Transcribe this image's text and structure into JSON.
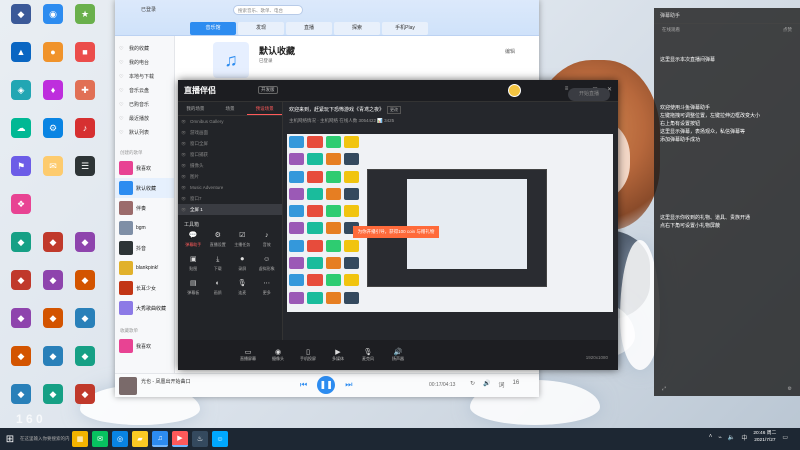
{
  "colors": {
    "accent_blue": "#2d8cf0",
    "stream_red": "#ff5a5a",
    "banner_orange": "#ff6a3a",
    "taskbar": "#1d2733"
  },
  "desktop": {
    "icons": [
      {
        "label": "desktop-icon-1",
        "icon": "shortcut-icon",
        "color": "#3b5998"
      },
      {
        "label": "desktop-icon-2",
        "icon": "shortcut-icon",
        "color": "#2d8cf0"
      },
      {
        "label": "desktop-icon-3",
        "icon": "shortcut-icon",
        "color": "#6ab04c"
      },
      {
        "label": "desktop-icon-4",
        "icon": "shortcut-icon",
        "color": "#0a66c2"
      },
      {
        "label": "desktop-icon-5",
        "icon": "shortcut-icon",
        "color": "#f0932b"
      },
      {
        "label": "desktop-icon-6",
        "icon": "shortcut-icon",
        "color": "#eb4d4b"
      },
      {
        "label": "desktop-icon-7",
        "icon": "shortcut-icon",
        "color": "#22a6b3"
      },
      {
        "label": "desktop-icon-8",
        "icon": "shortcut-icon",
        "color": "#be2edd"
      },
      {
        "label": "desktop-icon-9",
        "icon": "shortcut-icon",
        "color": "#e17055"
      },
      {
        "label": "desktop-icon-10",
        "icon": "shortcut-icon",
        "color": "#00b894"
      },
      {
        "label": "desktop-icon-11",
        "icon": "shortcut-icon",
        "color": "#0984e3"
      },
      {
        "label": "desktop-icon-12",
        "icon": "shortcut-icon",
        "color": "#d63031"
      },
      {
        "label": "desktop-icon-13",
        "icon": "shortcut-icon",
        "color": "#6c5ce7"
      },
      {
        "label": "desktop-icon-14",
        "icon": "shortcut-icon",
        "color": "#fdcb6e"
      },
      {
        "label": "desktop-icon-15",
        "icon": "shortcut-icon",
        "color": "#2d3436"
      },
      {
        "label": "desktop-icon-16",
        "icon": "shortcut-icon",
        "color": "#e84393"
      }
    ]
  },
  "music": {
    "user": "已登录",
    "search_placeholder": "搜索音乐、歌单、电台",
    "tabs": [
      {
        "label": "音乐馆",
        "active": true
      },
      {
        "label": "发现",
        "active": false
      },
      {
        "label": "直播",
        "active": false
      },
      {
        "label": "探索",
        "active": false
      },
      {
        "label": "手机Play",
        "active": false
      }
    ],
    "side_items": [
      {
        "label": "我的收藏",
        "selected": false
      },
      {
        "label": "我的电台",
        "selected": false
      },
      {
        "label": "本地与下载",
        "selected": false
      },
      {
        "label": "音乐云盘",
        "selected": false
      },
      {
        "label": "已购音乐",
        "selected": false
      },
      {
        "label": "最近播放",
        "selected": false
      },
      {
        "label": "默认列表",
        "selected": false
      }
    ],
    "playlist_section": "创建的歌单",
    "playlists": [
      {
        "label": "我喜欢",
        "color": "#e84393"
      },
      {
        "label": "默认收藏",
        "color": "#2d8cf0"
      },
      {
        "label": "伴奏",
        "color": "#9b6b6b"
      },
      {
        "label": "bgm",
        "color": "#7f8fa6"
      },
      {
        "label": "抖音",
        "color": "#2d3436"
      },
      {
        "label": "blankpink!",
        "color": "#e1b12c"
      },
      {
        "label": "长耳少女",
        "color": "#c23616"
      },
      {
        "label": "大秀歌曲收藏",
        "color": "#8c7ae6"
      }
    ],
    "playlist_section_2": "收藏歌单",
    "playlist_extra": "我喜欢",
    "header_title": "默认收藏",
    "header_sub": "已登录",
    "edit_label": "编辑",
    "player_song": "光也 - 凤凰出开始曲口",
    "player_time": "00:17/04:13",
    "player_count": "16"
  },
  "stream": {
    "logo": "直播伴侣",
    "version": "开发版",
    "left_tabs": [
      {
        "label": "我的场景",
        "active": false
      },
      {
        "label": "场景",
        "active": false
      },
      {
        "label": "预设场景",
        "active": true
      }
    ],
    "scenes": [
      {
        "label": "Omnibus Gallery",
        "selected": false
      },
      {
        "label": "游戏画面",
        "selected": false
      },
      {
        "label": "窗口全屏",
        "selected": false
      },
      {
        "label": "窗口捕获",
        "selected": false
      },
      {
        "label": "摄像头",
        "selected": false
      },
      {
        "label": "图片",
        "selected": false
      },
      {
        "label": "Music Adventure",
        "selected": false
      },
      {
        "label": "窗口7",
        "selected": false
      },
      {
        "label": "全屏 1",
        "selected": true
      }
    ],
    "tools_title": "工具箱",
    "tools": [
      {
        "label": "弹幕助手",
        "icon": "chat-icon",
        "hl": true
      },
      {
        "label": "直播设置",
        "icon": "gear-icon",
        "hl": false
      },
      {
        "label": "主播任务",
        "icon": "task-icon",
        "hl": false
      },
      {
        "label": "音效",
        "icon": "sound-icon",
        "hl": false
      },
      {
        "label": "贴图",
        "icon": "image-icon",
        "hl": false
      },
      {
        "label": "下载",
        "icon": "download-icon",
        "hl": false
      },
      {
        "label": "录屏",
        "icon": "record-icon",
        "hl": false
      },
      {
        "label": "虚拟形象",
        "icon": "avatar-icon",
        "hl": false
      },
      {
        "label": "弹幕板",
        "icon": "board-icon",
        "hl": false
      },
      {
        "label": "画质",
        "icon": "quality-icon",
        "hl": false
      },
      {
        "label": "连麦",
        "icon": "mic-icon",
        "hl": false
      },
      {
        "label": "更多",
        "icon": "more-icon",
        "hl": false
      }
    ],
    "title_line": "欢迎来到，赶紧玩下恐怖游戏《青鸢之夜》",
    "title_tag": "更改",
    "stats_line": "主机网络情况 · 主机网络   在线人数 3054422   📊 3425",
    "banner": "为你开播引导，获得100 coin 与赠礼物",
    "bottom": [
      {
        "label": "直播屏幕",
        "icon": "screen-icon"
      },
      {
        "label": "摄像头",
        "icon": "camera-icon"
      },
      {
        "label": "手机投屏",
        "icon": "phone-icon"
      },
      {
        "label": "多媒体",
        "icon": "media-icon"
      },
      {
        "label": "麦克风",
        "icon": "mic-icon"
      },
      {
        "label": "扬声器",
        "icon": "speaker-icon"
      }
    ],
    "start_label": "开始直播",
    "resolution": "1920x1080"
  },
  "chat": {
    "header": "弹幕助手",
    "stats_left": "在线观看",
    "stats_right": "点赞",
    "messages": [
      "这里显示本次直播间弹幕",
      "",
      "欢迎使用斗鱼弹幕助手",
      "左键拖拽可调整位置，左键拉伸边框改变大小",
      "右上角有设置按钮",
      "这里显示弹幕，表扬观众，私信弹幕等",
      "添加弹幕助手成功",
      "",
      "这里显示你收到的礼物、道具、贵族开通",
      "点右下角可设置小礼物屏蔽"
    ],
    "foot_left": "⤢",
    "foot_right": "⚙"
  },
  "taskbar": {
    "search": "在这里输入你要搜索的内容",
    "apps": [
      {
        "icon": "explorer-icon",
        "color": "#f4b400"
      },
      {
        "icon": "wechat-icon",
        "color": "#07c160"
      },
      {
        "icon": "browser-icon",
        "color": "#0984e3"
      },
      {
        "icon": "folder-icon",
        "color": "#f9ca24"
      },
      {
        "icon": "music-app-icon",
        "color": "#2d8cf0"
      },
      {
        "icon": "stream-app-icon",
        "color": "#ff5a5a"
      },
      {
        "icon": "steam-icon",
        "color": "#34495e"
      },
      {
        "icon": "qq-icon",
        "color": "#00a8ff"
      }
    ],
    "time": "20:46 周二",
    "date": "2021/7/27"
  },
  "watermark": "1 6 0"
}
